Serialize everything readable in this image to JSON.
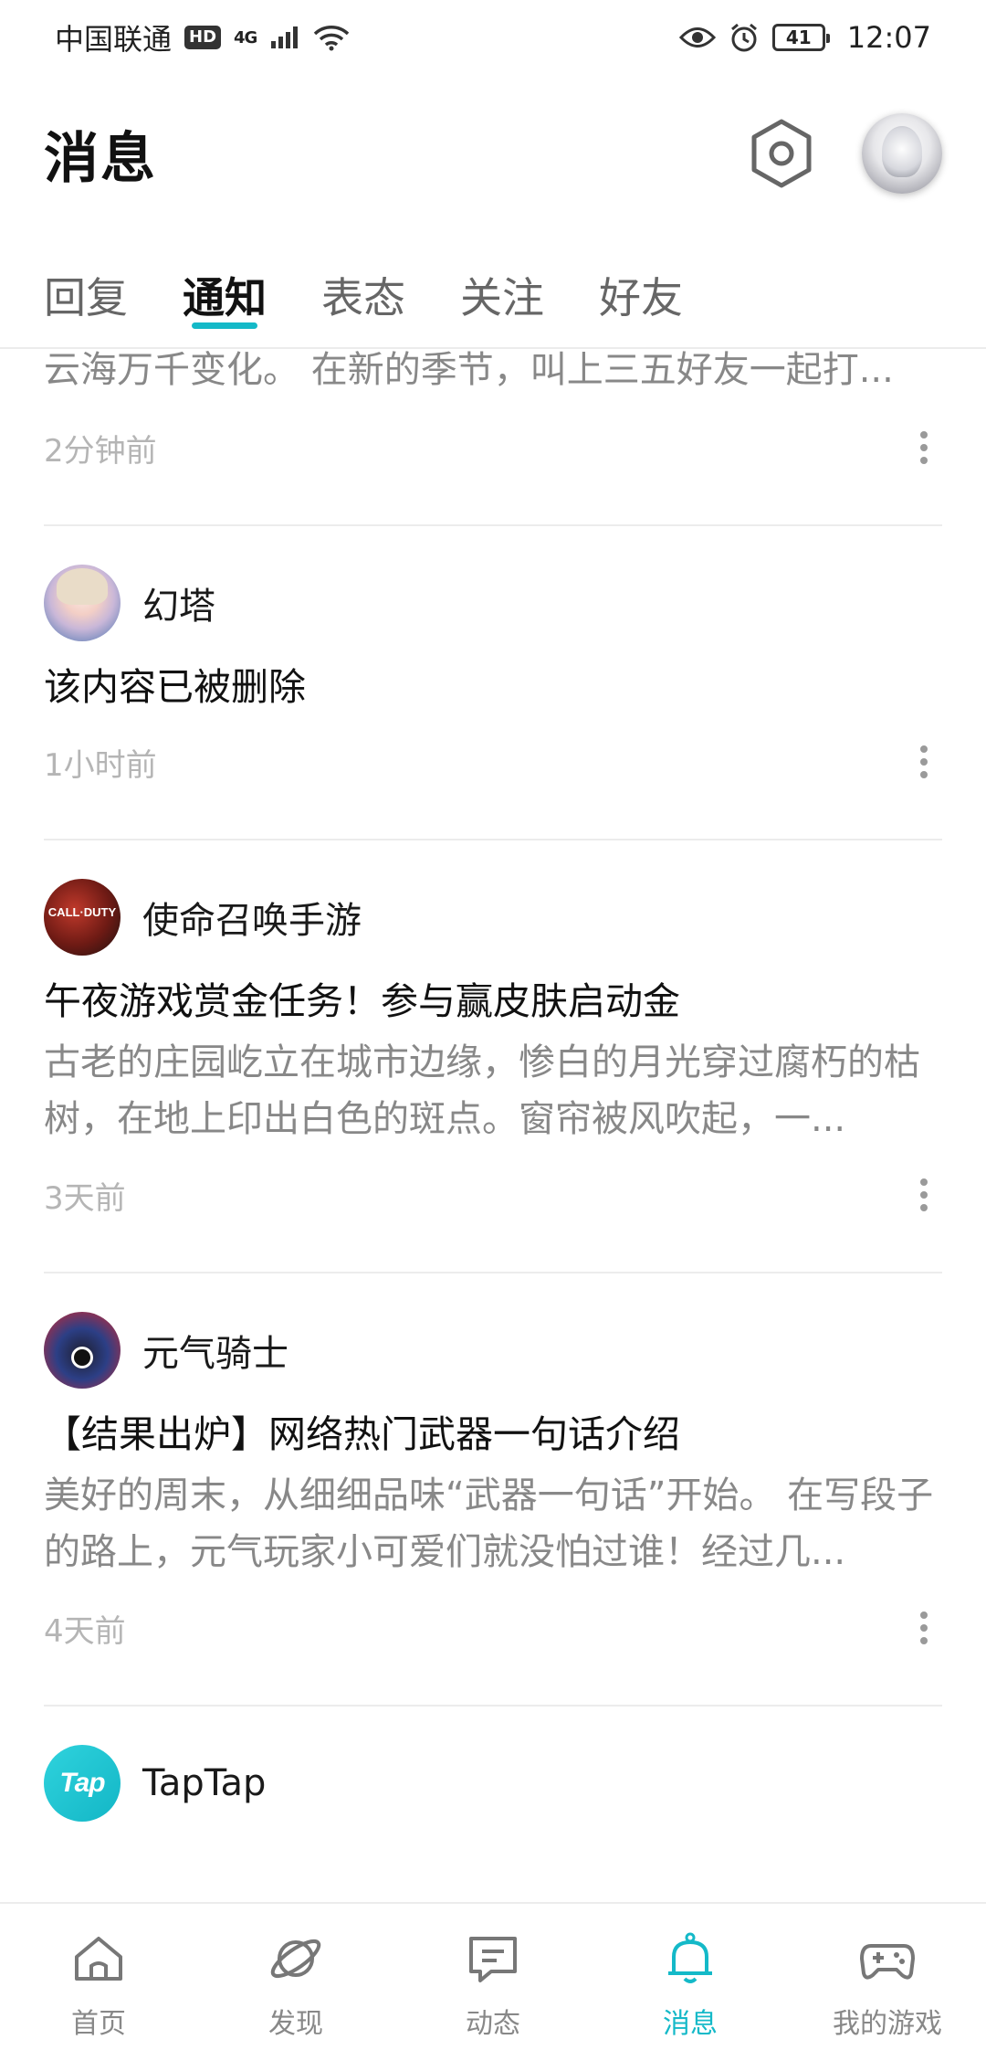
{
  "status_bar": {
    "carrier": "中国联通",
    "hd": "HD",
    "network": "4G",
    "battery": "41",
    "time": "12:07"
  },
  "header": {
    "title": "消息",
    "settings_icon": "hexagon-settings-icon"
  },
  "tabs": [
    {
      "label": "回复",
      "active": false
    },
    {
      "label": "通知",
      "active": true
    },
    {
      "label": "表态",
      "active": false
    },
    {
      "label": "关注",
      "active": false
    },
    {
      "label": "好友",
      "active": false
    }
  ],
  "feed": {
    "partial": {
      "body": "云海万千变化。 在新的季节，叫上三五好友一起打...",
      "time": "2分钟前"
    },
    "items": [
      {
        "name": "幻塔",
        "title": "该内容已被删除",
        "body": "",
        "time": "1小时前"
      },
      {
        "name": "使命召唤手游",
        "avatar_text": "CALL·DUTY",
        "title": "午夜游戏赏金任务！参与赢皮肤启动金",
        "body": "古老的庄园屹立在城市边缘，惨白的月光穿过腐朽的枯树，在地上印出白色的斑点。窗帘被风吹起，一...",
        "time": "3天前"
      },
      {
        "name": "元气骑士",
        "title": "【结果出炉】网络热门武器一句话介绍",
        "body": "美好的周末，从细细品味“武器一句话”开始。 在写段子的路上，元气玩家小可爱们就没怕过谁！经过几...",
        "time": "4天前"
      },
      {
        "name": "TapTap",
        "avatar_text": "Tap"
      }
    ]
  },
  "bottom_nav": [
    {
      "label": "首页",
      "icon": "home-icon",
      "active": false
    },
    {
      "label": "发现",
      "icon": "discover-planet-icon",
      "active": false
    },
    {
      "label": "动态",
      "icon": "chat-bubble-icon",
      "active": false
    },
    {
      "label": "消息",
      "icon": "bell-icon",
      "active": true
    },
    {
      "label": "我的游戏",
      "icon": "gamepad-icon",
      "active": false
    }
  ],
  "colors": {
    "accent": "#14b9c8",
    "muted_text": "#888888",
    "time_text": "#b5b5b5"
  }
}
